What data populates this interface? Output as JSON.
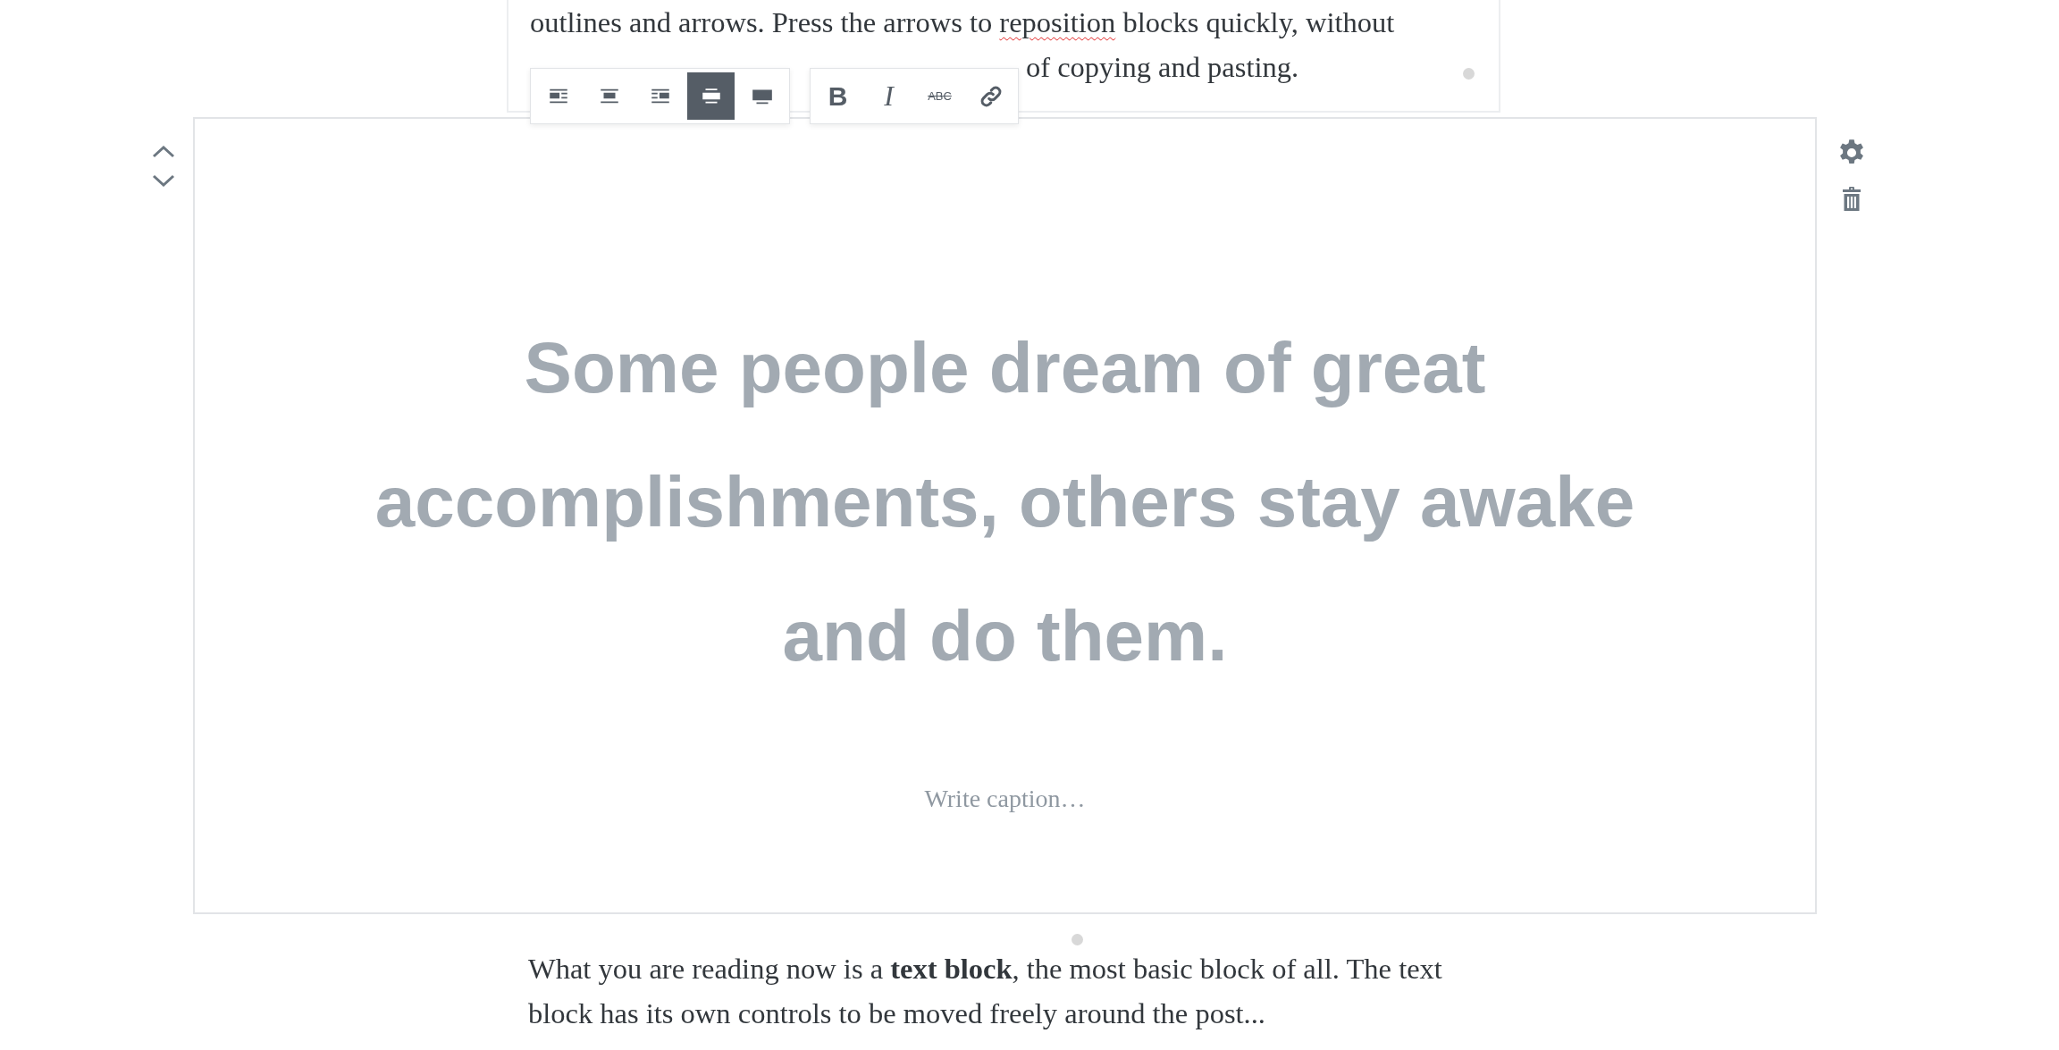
{
  "top_paragraph": {
    "segments": [
      {
        "text": "outlines and arrows. Press the arrows to ",
        "misspelled": false
      },
      {
        "text": "reposition",
        "misspelled": true
      },
      {
        "text": " blocks quickly, without",
        "misspelled": false
      }
    ],
    "visible_end": "of copying and pasting."
  },
  "toolbar": {
    "alignment": [
      {
        "kind": "wrap-left",
        "selected": false
      },
      {
        "kind": "center",
        "selected": false
      },
      {
        "kind": "wrap-right",
        "selected": false
      },
      {
        "kind": "wide",
        "selected": true
      },
      {
        "kind": "full",
        "selected": false
      }
    ],
    "formatting": [
      {
        "kind": "bold",
        "label": "B"
      },
      {
        "kind": "italic",
        "label": "I"
      },
      {
        "kind": "strikethrough",
        "label": "ABC"
      },
      {
        "kind": "link"
      }
    ]
  },
  "cover_block": {
    "heading": "Some people dream of great accomplishments, others stay awake and do them.",
    "caption": {
      "placeholder": "Write caption…"
    }
  },
  "bottom_paragraph": "What you are reading now is a **text block**, the most basic block of all. The text block has its own controls to be moved freely around the post..."
}
